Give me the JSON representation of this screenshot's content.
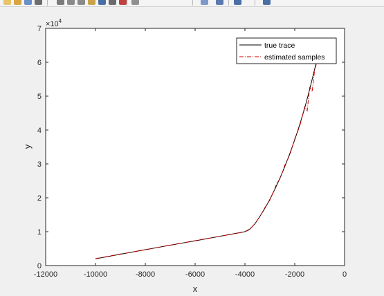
{
  "toolbar": {
    "icons": [
      {
        "name": "new-figure-icon",
        "color": "#e8c36a"
      },
      {
        "name": "open-file-icon",
        "color": "#d9a441"
      },
      {
        "name": "save-figure-icon",
        "color": "#6b8fc7"
      },
      {
        "name": "print-figure-icon",
        "color": "#6d6d6d"
      },
      {
        "name": "edit-plot-icon",
        "color": "#7a7a7a"
      },
      {
        "name": "zoom-in-icon",
        "color": "#8a8a8a"
      },
      {
        "name": "zoom-out-icon",
        "color": "#8a8a8a"
      },
      {
        "name": "pan-icon",
        "color": "#c9a24b"
      },
      {
        "name": "rotate-3d-icon",
        "color": "#4a6fa5"
      },
      {
        "name": "data-cursor-icon",
        "color": "#6b6b6b"
      },
      {
        "name": "brush-icon",
        "color": "#c04040"
      },
      {
        "name": "link-plot-icon",
        "color": "#909090"
      },
      {
        "name": "insert-colorbar-icon",
        "color": "#7d99c9"
      },
      {
        "name": "insert-legend-icon",
        "color": "#5b79b0"
      },
      {
        "name": "hide-plot-tools-icon",
        "color": "#4a6fa5"
      },
      {
        "name": "show-plot-tools-icon",
        "color": "#4a6fa5"
      }
    ]
  },
  "chart_data": {
    "type": "line",
    "title": "",
    "xlabel": "x",
    "ylabel": "y",
    "xlim": [
      -12000,
      0
    ],
    "ylim": [
      0,
      70000
    ],
    "exponent_label": {
      "base": "×10",
      "exp": "4"
    },
    "xticks": [
      -12000,
      -10000,
      -8000,
      -6000,
      -4000,
      -2000,
      0
    ],
    "xtick_labels": [
      "-12000",
      "-10000",
      "-8000",
      "-6000",
      "-4000",
      "-2000",
      "0"
    ],
    "yticks": [
      0,
      10000,
      20000,
      30000,
      40000,
      50000,
      60000,
      70000
    ],
    "ytick_labels": [
      "0",
      "1",
      "2",
      "3",
      "4",
      "5",
      "6",
      "7"
    ],
    "grid": false,
    "legend_position": "top-right",
    "series": [
      {
        "name": "true trace",
        "color": "#000000",
        "style": "solid",
        "x": [
          -10000,
          -8000,
          -6000,
          -4000,
          -3800,
          -3600,
          -3400,
          -3200,
          -3000,
          -2800,
          -2600,
          -2400,
          -2200,
          -2000,
          -1800,
          -1600,
          -1400,
          -1200,
          -1100
        ],
        "y": [
          2000,
          4700,
          7300,
          10000,
          10800,
          12300,
          14500,
          16900,
          19500,
          22500,
          25700,
          29200,
          33000,
          37100,
          41600,
          46500,
          52000,
          58000,
          61000
        ]
      },
      {
        "name": "estimated samples",
        "color": "#cc0000",
        "style": "dashdot",
        "x": [
          -10000,
          -9000,
          -8000,
          -7000,
          -6000,
          -5000,
          -4000,
          -3800,
          -3600,
          -3400,
          -3200,
          -3000,
          -2800,
          -2700,
          -2600,
          -2400,
          -2200,
          -2000,
          -1800,
          -1600,
          -1500,
          -1400,
          -1300,
          -1200,
          -1100
        ],
        "y": [
          2050,
          3400,
          4650,
          6050,
          7350,
          8650,
          9950,
          10700,
          12400,
          14400,
          17100,
          19300,
          22800,
          24600,
          25500,
          29600,
          32600,
          37400,
          41100,
          46900,
          45700,
          52600,
          51300,
          57800,
          60300
        ]
      }
    ]
  }
}
